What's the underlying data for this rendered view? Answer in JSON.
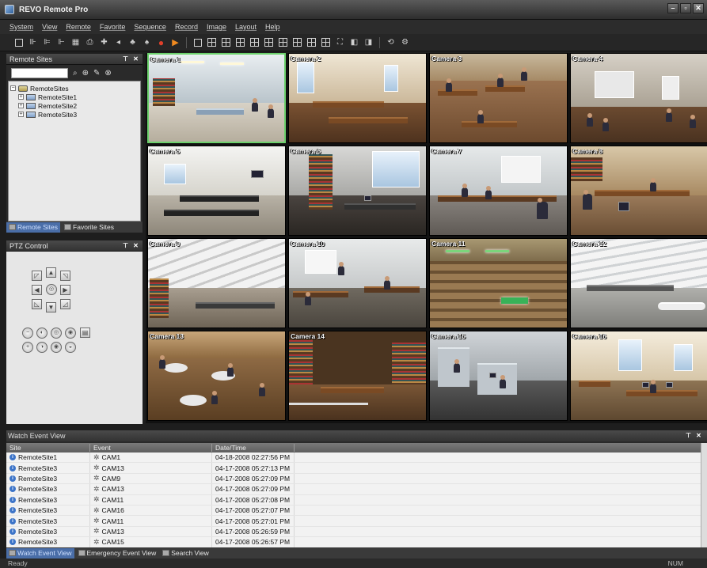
{
  "app": {
    "title": "REVO Remote Pro"
  },
  "menu": [
    "System",
    "View",
    "Remote",
    "Favorite",
    "Sequence",
    "Record",
    "Image",
    "Layout",
    "Help"
  ],
  "remote_sites_panel": {
    "title": "Remote Sites",
    "search_value": "",
    "tree": {
      "root": "RemoteSites",
      "children": [
        "RemoteSite1",
        "RemoteSite2",
        "RemoteSite3"
      ]
    },
    "tabs": [
      "Remote Sites",
      "Favorite Sites"
    ],
    "active_tab": "Remote Sites"
  },
  "ptz_panel": {
    "title": "PTZ Control"
  },
  "cameras": [
    "Camera 1",
    "Camera 2",
    "Camera 3",
    "Camera 4",
    "Camera 5",
    "Camera 6",
    "Camera 7",
    "Camera 8",
    "Camera 9",
    "Camera 10",
    "Camera 11",
    "Camera 12",
    "Camera 13",
    "Camera 14",
    "Camera 15",
    "Camera 16"
  ],
  "selected_camera": "Camera 1",
  "event_view": {
    "title": "Watch Event View",
    "columns": {
      "site": "Site",
      "event": "Event",
      "date": "Date/Time"
    },
    "rows": [
      {
        "site": "RemoteSite1",
        "event": "CAM1",
        "date": "04-18-2008  02:27:56 PM"
      },
      {
        "site": "RemoteSite3",
        "event": "CAM13",
        "date": "04-17-2008  05:27:13 PM"
      },
      {
        "site": "RemoteSite3",
        "event": "CAM9",
        "date": "04-17-2008  05:27:09 PM"
      },
      {
        "site": "RemoteSite3",
        "event": "CAM13",
        "date": "04-17-2008  05:27:09 PM"
      },
      {
        "site": "RemoteSite3",
        "event": "CAM11",
        "date": "04-17-2008  05:27:08 PM"
      },
      {
        "site": "RemoteSite3",
        "event": "CAM16",
        "date": "04-17-2008  05:27:07 PM"
      },
      {
        "site": "RemoteSite3",
        "event": "CAM11",
        "date": "04-17-2008  05:27:01 PM"
      },
      {
        "site": "RemoteSite3",
        "event": "CAM13",
        "date": "04-17-2008  05:26:59 PM"
      },
      {
        "site": "RemoteSite3",
        "event": "CAM15",
        "date": "04-17-2008  05:26:57 PM"
      }
    ],
    "tabs": [
      "Watch Event View",
      "Emergency Event View",
      "Search View"
    ],
    "active_tab": "Watch Event View"
  },
  "status": {
    "left": "Ready",
    "right": "NUM"
  },
  "colors": {
    "selected_border": "#6cd16c",
    "active_tab": "#4a6ea8",
    "background": "#1e1e1e"
  }
}
